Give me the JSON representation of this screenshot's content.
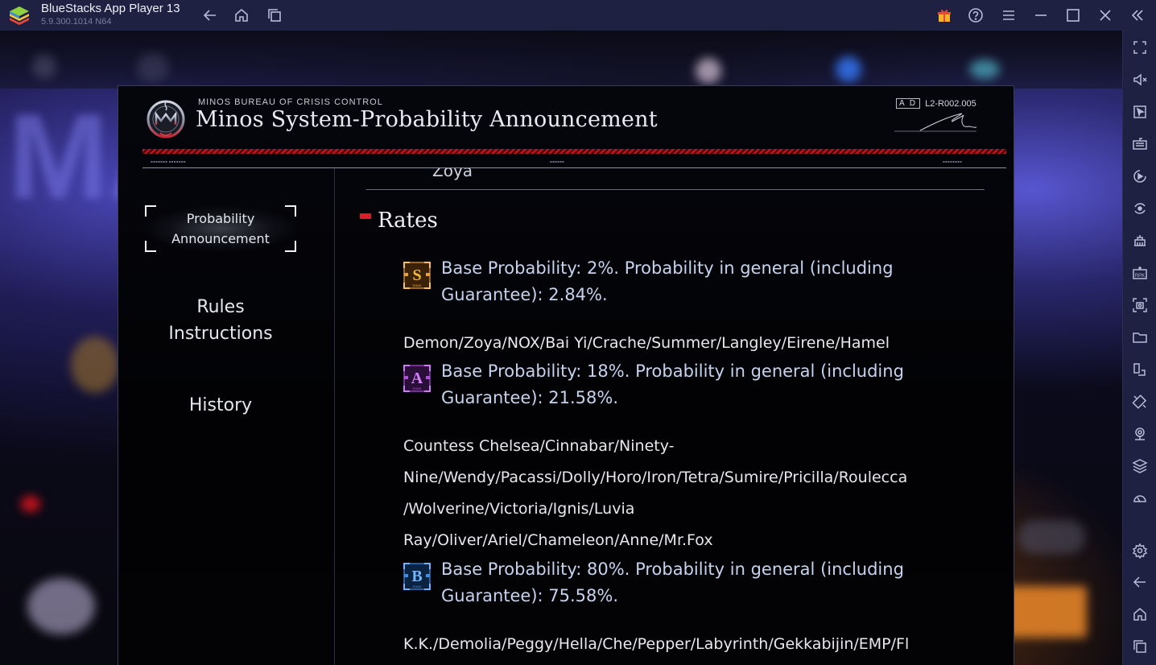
{
  "window": {
    "app_name": "BlueStacks App Player 13",
    "version": "5.9.300.1014  N64",
    "title_icons": [
      "back-icon",
      "home-icon",
      "recent-apps-icon",
      "gift-icon",
      "help-icon",
      "menu-icon",
      "minimize-icon",
      "maximize-icon",
      "close-icon",
      "collapse-sidebar-icon"
    ]
  },
  "sidebar_tools": [
    "fullscreen-icon",
    "mute-icon",
    "macro-pointer-icon",
    "keyboard-icon",
    "record-icon",
    "sync-icon",
    "multi-instance-icon",
    "install-apk-icon",
    "screenshot-icon",
    "folder-icon",
    "multi-display-icon",
    "rotate-icon",
    "location-icon",
    "layers-icon",
    "performance-icon",
    "settings-icon",
    "back-icon",
    "home-icon",
    "recent-apps-icon"
  ],
  "modal": {
    "bureau": "MINOS BUREAU OF CRISIS CONTROL",
    "title": "Minos System-Probability Announcement",
    "code_tag": "A D",
    "code": "L2-R002.005",
    "accent_color": "#d51f2a"
  },
  "nav": {
    "items": [
      {
        "label_line1": "Probability",
        "label_line2": "Announcement",
        "active": true
      },
      {
        "label_line1": "Rules",
        "label_line2": "Instructions",
        "active": false
      },
      {
        "label_line1": "History",
        "label_line2": "",
        "active": false
      }
    ]
  },
  "content": {
    "previous_text": "Zoya",
    "section_title": "Rates",
    "ranks": [
      {
        "rank": "S",
        "badge_color": "#e8a23a",
        "line1": "Base Probability: 2%. Probability in general (including",
        "line2": "Guarantee): 2.84%.",
        "base_probability_pct": 2,
        "general_probability_pct": 2.84,
        "names": [
          "Demon/Zoya/NOX/Bai Yi/Crache/Summer/Langley/Eirene/Hamel"
        ]
      },
      {
        "rank": "A",
        "badge_color": "#b44ee0",
        "line1": "Base Probability: 18%. Probability in general (including",
        "line2": "Guarantee): 21.58%.",
        "base_probability_pct": 18,
        "general_probability_pct": 21.58,
        "names": [
          "Countess Chelsea/Cinnabar/Ninety-",
          "Nine/Wendy/Pacassi/Dolly/Horo/Iron/Tetra/Sumire/Pricilla/Roulecca",
          "/Wolverine/Victoria/Ignis/Luvia",
          "Ray/Oliver/Ariel/Chameleon/Anne/Mr.Fox"
        ]
      },
      {
        "rank": "B",
        "badge_color": "#3f8fe6",
        "line1": "Base Probability: 80%. Probability in general (including",
        "line2": "Guarantee): 75.58%.",
        "base_probability_pct": 80,
        "general_probability_pct": 75.58,
        "names": [
          "K.K./Demolia/Peggy/Hella/Che/Pepper/Labyrinth/Gekkabijin/EMP/Fl"
        ]
      }
    ]
  }
}
